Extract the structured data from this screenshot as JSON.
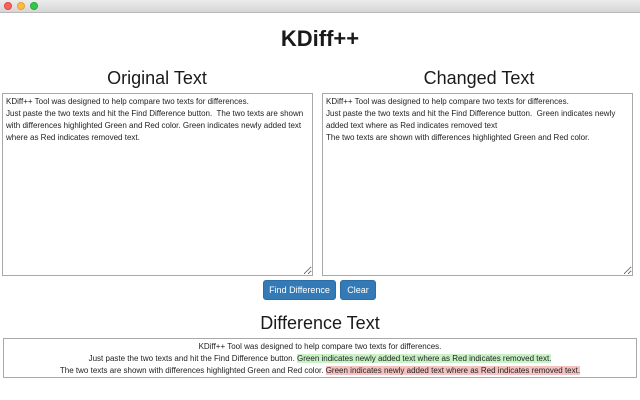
{
  "window": {
    "title": ""
  },
  "app": {
    "title": "KDiff++"
  },
  "original": {
    "heading": "Original Text",
    "text": "KDiff++ Tool was designed to help compare two texts for differences.\nJust paste the two texts and hit the Find Difference button.  The two texts are shown with differences highlighted Green and Red color. Green indicates newly added text where as Red indicates removed text."
  },
  "changed": {
    "heading": "Changed Text",
    "text": "KDiff++ Tool was designed to help compare two texts for differences.\nJust paste the two texts and hit the Find Difference button.  Green indicates newly added text where as Red indicates removed text\nThe two texts are shown with differences highlighted Green and Red color."
  },
  "buttons": {
    "find_label": "Find Difference",
    "clear_label": "Clear"
  },
  "difference": {
    "heading": "Difference Text",
    "lines": [
      {
        "plain": "KDiff++ Tool was designed to help compare two texts for differences.",
        "added": "",
        "removed": ""
      },
      {
        "plain": "Just paste the two texts and hit the Find Difference button. ",
        "added": "Green indicates newly added text where as Red indicates removed text.",
        "removed": ""
      },
      {
        "plain": "The two texts are shown with differences highlighted Green and Red color. ",
        "added": "",
        "removed": "Green indicates newly added text where as Red indicates removed text."
      }
    ]
  },
  "colors": {
    "accent": "#337ab7",
    "added_bg": "#c9f2c7",
    "removed_bg": "#f5c2c2"
  }
}
